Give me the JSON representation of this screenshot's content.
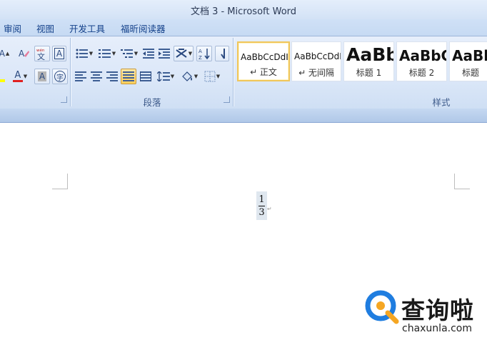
{
  "window": {
    "title": "文档 3 - Microsoft Word"
  },
  "tabs": [
    {
      "label": "审阅"
    },
    {
      "label": "视图"
    },
    {
      "label": "开发工具"
    },
    {
      "label": "福昕阅读器"
    }
  ],
  "font_group": {
    "phonetic_icon_text": "wén",
    "char_border_text": "A",
    "char_shade_text": "A",
    "font_color_text": "A",
    "enclose_char_text": "字",
    "grow_font_text": "A"
  },
  "paragraph_group": {
    "label": "段落"
  },
  "styles_group": {
    "label": "样式",
    "items": [
      {
        "sample": "AaBbCcDdI",
        "name": "↵ 正文",
        "selected": true
      },
      {
        "sample": "AaBbCcDdI",
        "name": "↵ 无间隔",
        "selected": false
      },
      {
        "sample": "AaBb",
        "name": "标题 1",
        "selected": false
      },
      {
        "sample": "AaBbC",
        "name": "标题 2",
        "selected": false
      },
      {
        "sample": "AaBl",
        "name": "标题",
        "selected": false
      }
    ]
  },
  "document": {
    "fraction": {
      "numerator": "1",
      "denominator": "3"
    }
  },
  "watermark": {
    "brand": "查询啦",
    "url": "chaxunla.com"
  },
  "colors": {
    "accent": "#15428b",
    "font_color_underline": "#e02020",
    "watermark_blue": "#1f7de0",
    "watermark_orange": "#f5a623"
  }
}
